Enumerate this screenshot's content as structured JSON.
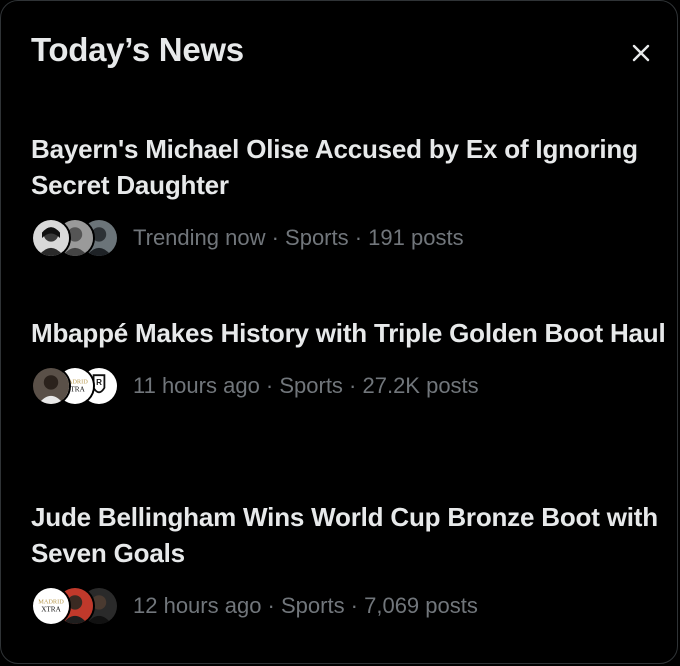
{
  "header": {
    "title": "Today’s News",
    "close_icon": "close-icon"
  },
  "news": [
    {
      "headline": "Bayern's Michael Olise Accused by Ex of Ignoring Secret Daughter",
      "meta": "Trending now · Sports · 191 posts",
      "avatar_icons": [
        "person-avatar",
        "person-avatar",
        "person-avatar"
      ]
    },
    {
      "headline": "Mbappé Makes History with Triple Golden Boot Haul",
      "meta": "11 hours ago · Sports · 27.2K posts",
      "avatar_icons": [
        "person-avatar",
        "madrid-xtra-logo",
        "team-logo"
      ],
      "avatar_text": {
        "logo": "MADRID\nXTRA",
        "crest": "R"
      }
    },
    {
      "headline": "Jude Bellingham Wins World Cup Bronze Boot with Seven Goals",
      "meta": "12 hours ago · Sports · 7,069 posts",
      "avatar_icons": [
        "madrid-xtra-logo",
        "person-avatar",
        "person-avatar"
      ],
      "avatar_text": {
        "logo": "MADRID\nXTRA"
      }
    }
  ],
  "colors": {
    "background": "#000000",
    "text_primary": "#e7e9ea",
    "text_secondary": "#71767b",
    "border": "#2f3336"
  }
}
